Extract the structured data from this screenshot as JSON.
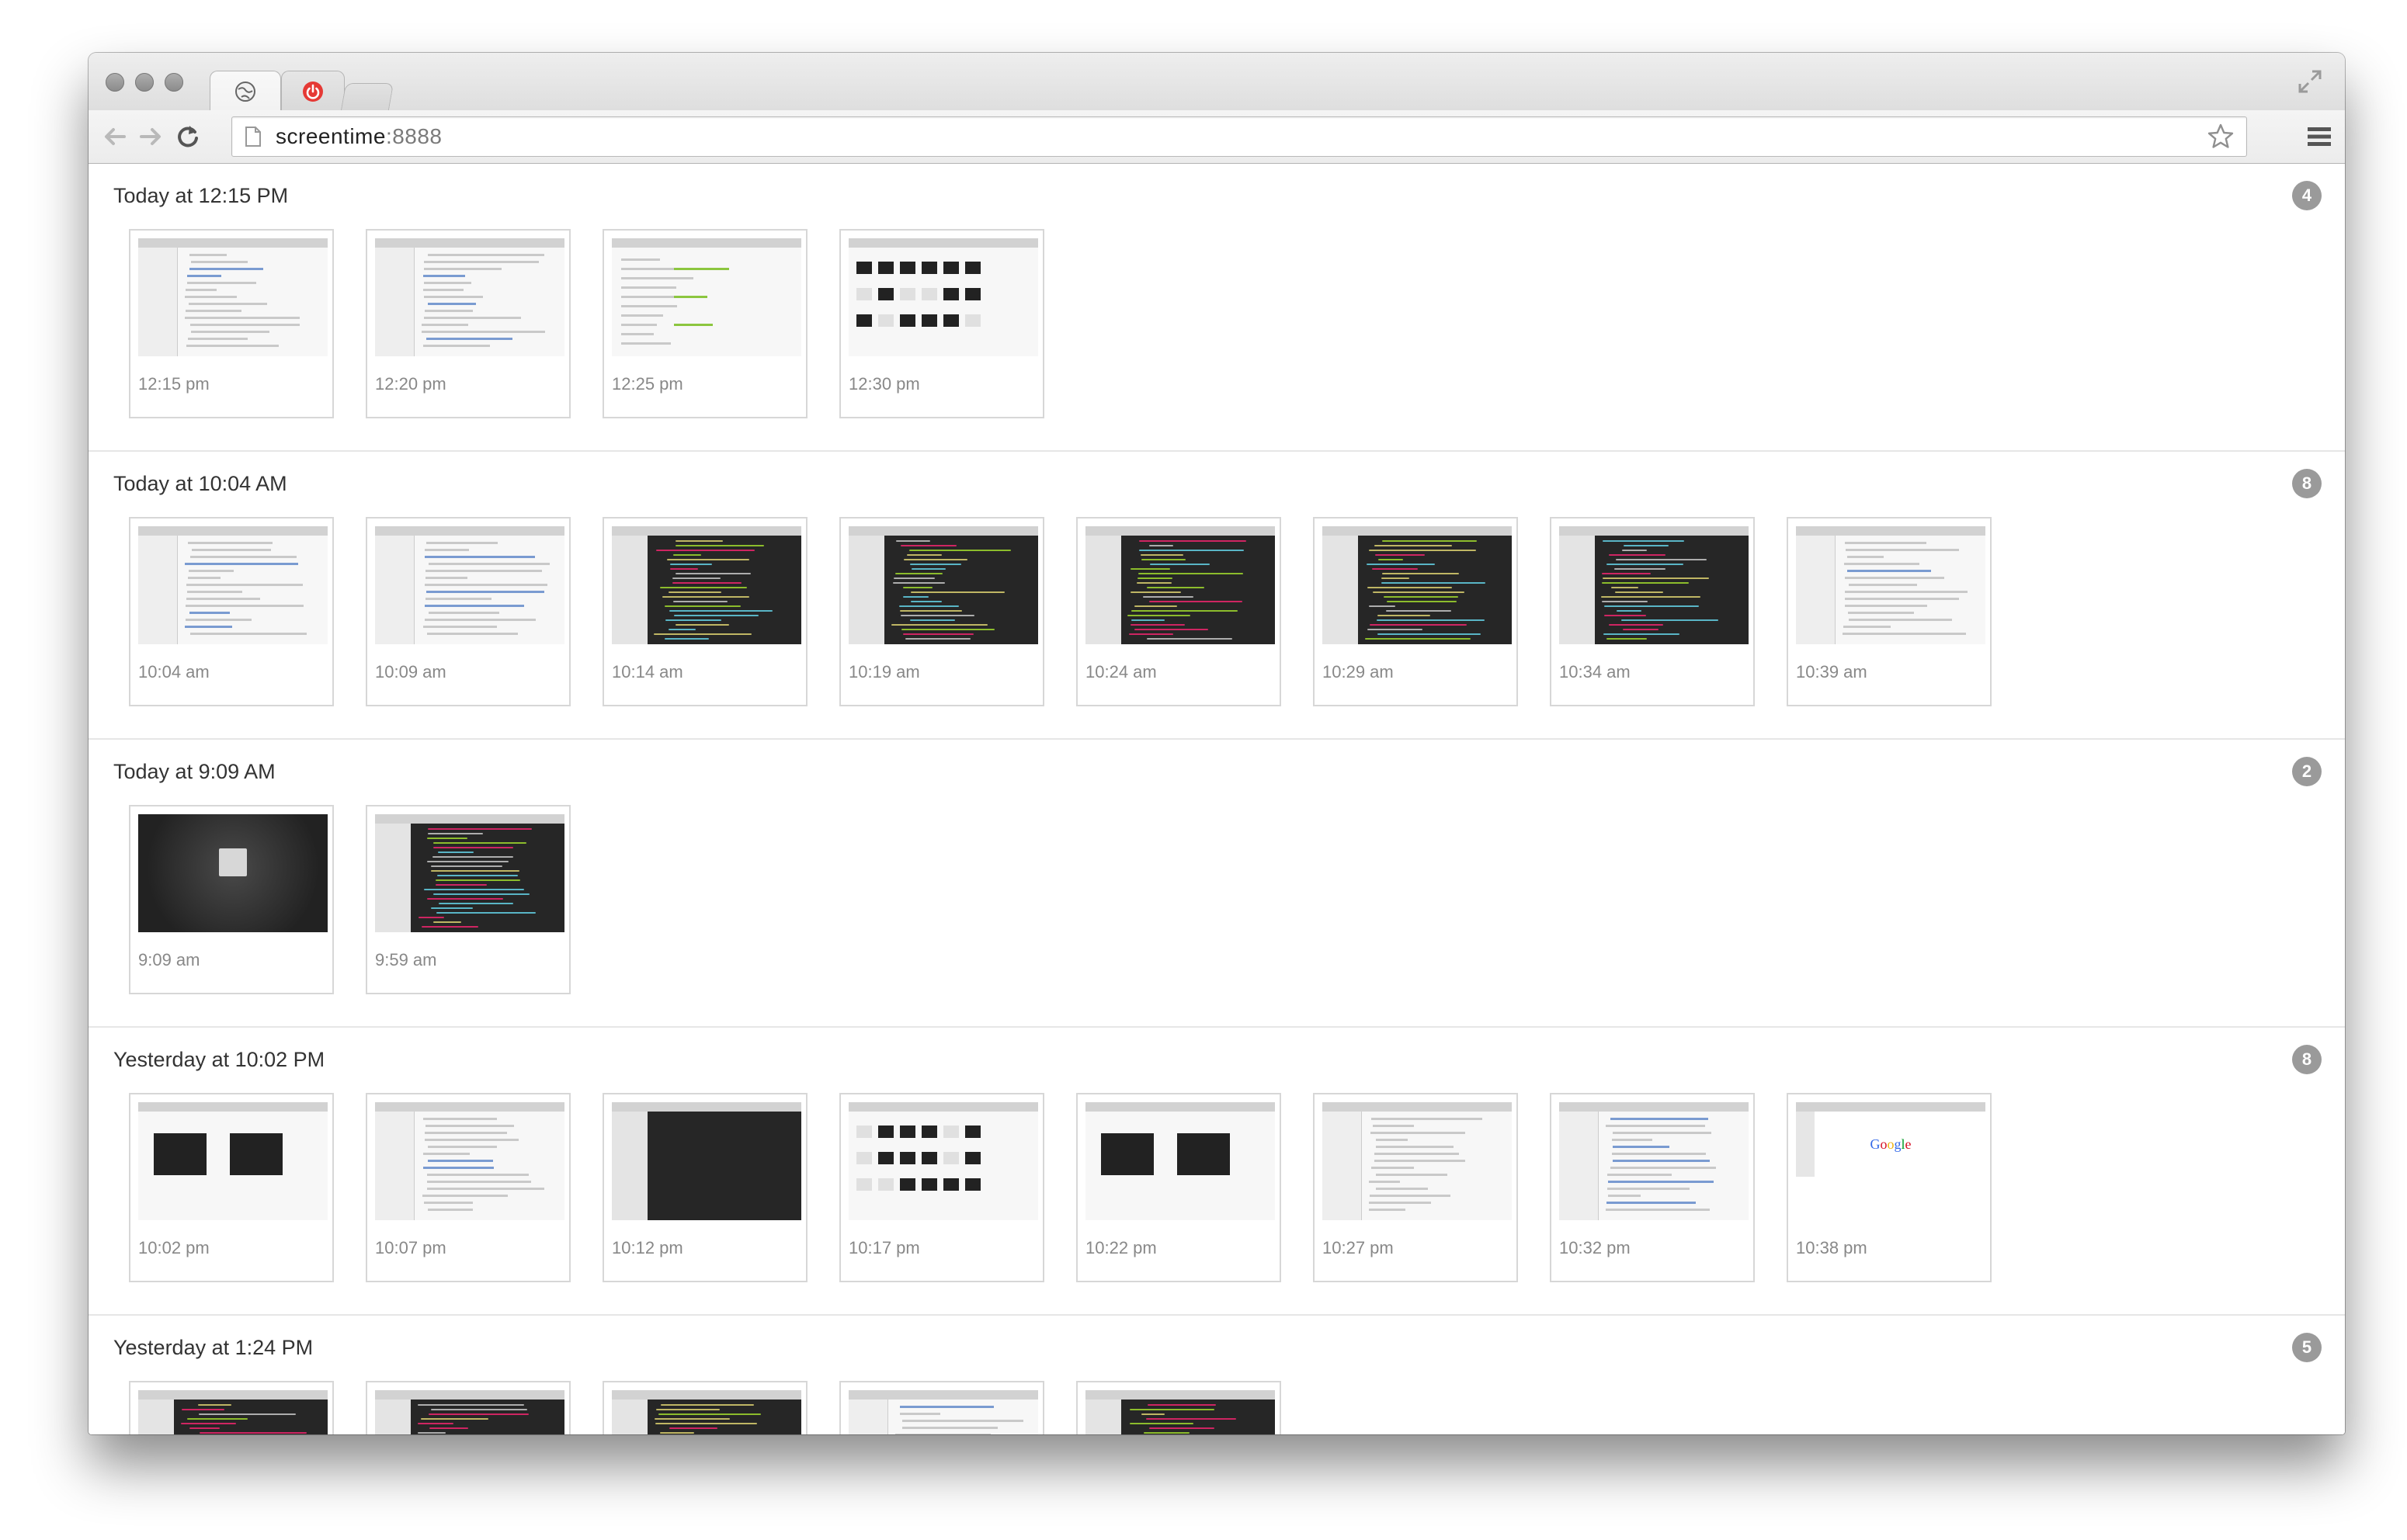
{
  "browser": {
    "url_host": "screentime",
    "url_port": ":8888",
    "tabs": [
      {
        "icon": "globe-icon",
        "active": true
      },
      {
        "icon": "power-icon",
        "active": false
      },
      {
        "icon": "new-tab",
        "active": false
      }
    ]
  },
  "groups": [
    {
      "title": "Today at 12:15 PM",
      "count": "4",
      "shots": [
        {
          "time": "12:15 pm",
          "style": "web"
        },
        {
          "time": "12:20 pm",
          "style": "web"
        },
        {
          "time": "12:25 pm",
          "style": "form"
        },
        {
          "time": "12:30 pm",
          "style": "grid"
        }
      ]
    },
    {
      "title": "Today at 10:04 AM",
      "count": "8",
      "shots": [
        {
          "time": "10:04 am",
          "style": "web"
        },
        {
          "time": "10:09 am",
          "style": "web"
        },
        {
          "time": "10:14 am",
          "style": "dark"
        },
        {
          "time": "10:19 am",
          "style": "dark"
        },
        {
          "time": "10:24 am",
          "style": "dark"
        },
        {
          "time": "10:29 am",
          "style": "dark"
        },
        {
          "time": "10:34 am",
          "style": "dark"
        },
        {
          "time": "10:39 am",
          "style": "web"
        }
      ]
    },
    {
      "title": "Today at 9:09 AM",
      "count": "2",
      "shots": [
        {
          "time": "9:09 am",
          "style": "login"
        },
        {
          "time": "9:59 am",
          "style": "dark"
        }
      ]
    },
    {
      "title": "Yesterday at 10:02 PM",
      "count": "8",
      "shots": [
        {
          "time": "10:02 pm",
          "style": "split"
        },
        {
          "time": "10:07 pm",
          "style": "web"
        },
        {
          "time": "10:12 pm",
          "style": "darkempty"
        },
        {
          "time": "10:17 pm",
          "style": "grid"
        },
        {
          "time": "10:22 pm",
          "style": "split"
        },
        {
          "time": "10:27 pm",
          "style": "web"
        },
        {
          "time": "10:32 pm",
          "style": "web"
        },
        {
          "time": "10:38 pm",
          "style": "google"
        }
      ]
    },
    {
      "title": "Yesterday at 1:24 PM",
      "count": "5",
      "shots": [
        {
          "time": "",
          "style": "dark"
        },
        {
          "time": "",
          "style": "dark"
        },
        {
          "time": "",
          "style": "dark"
        },
        {
          "time": "",
          "style": "web"
        },
        {
          "time": "",
          "style": "dark"
        }
      ]
    }
  ],
  "google_logo_text": "Google",
  "colors": {
    "badge": "#9a9a9a",
    "code_green": "#a6e22e",
    "code_yellow": "#e6db74",
    "code_pink": "#f92672",
    "code_blue": "#66d9ef"
  }
}
